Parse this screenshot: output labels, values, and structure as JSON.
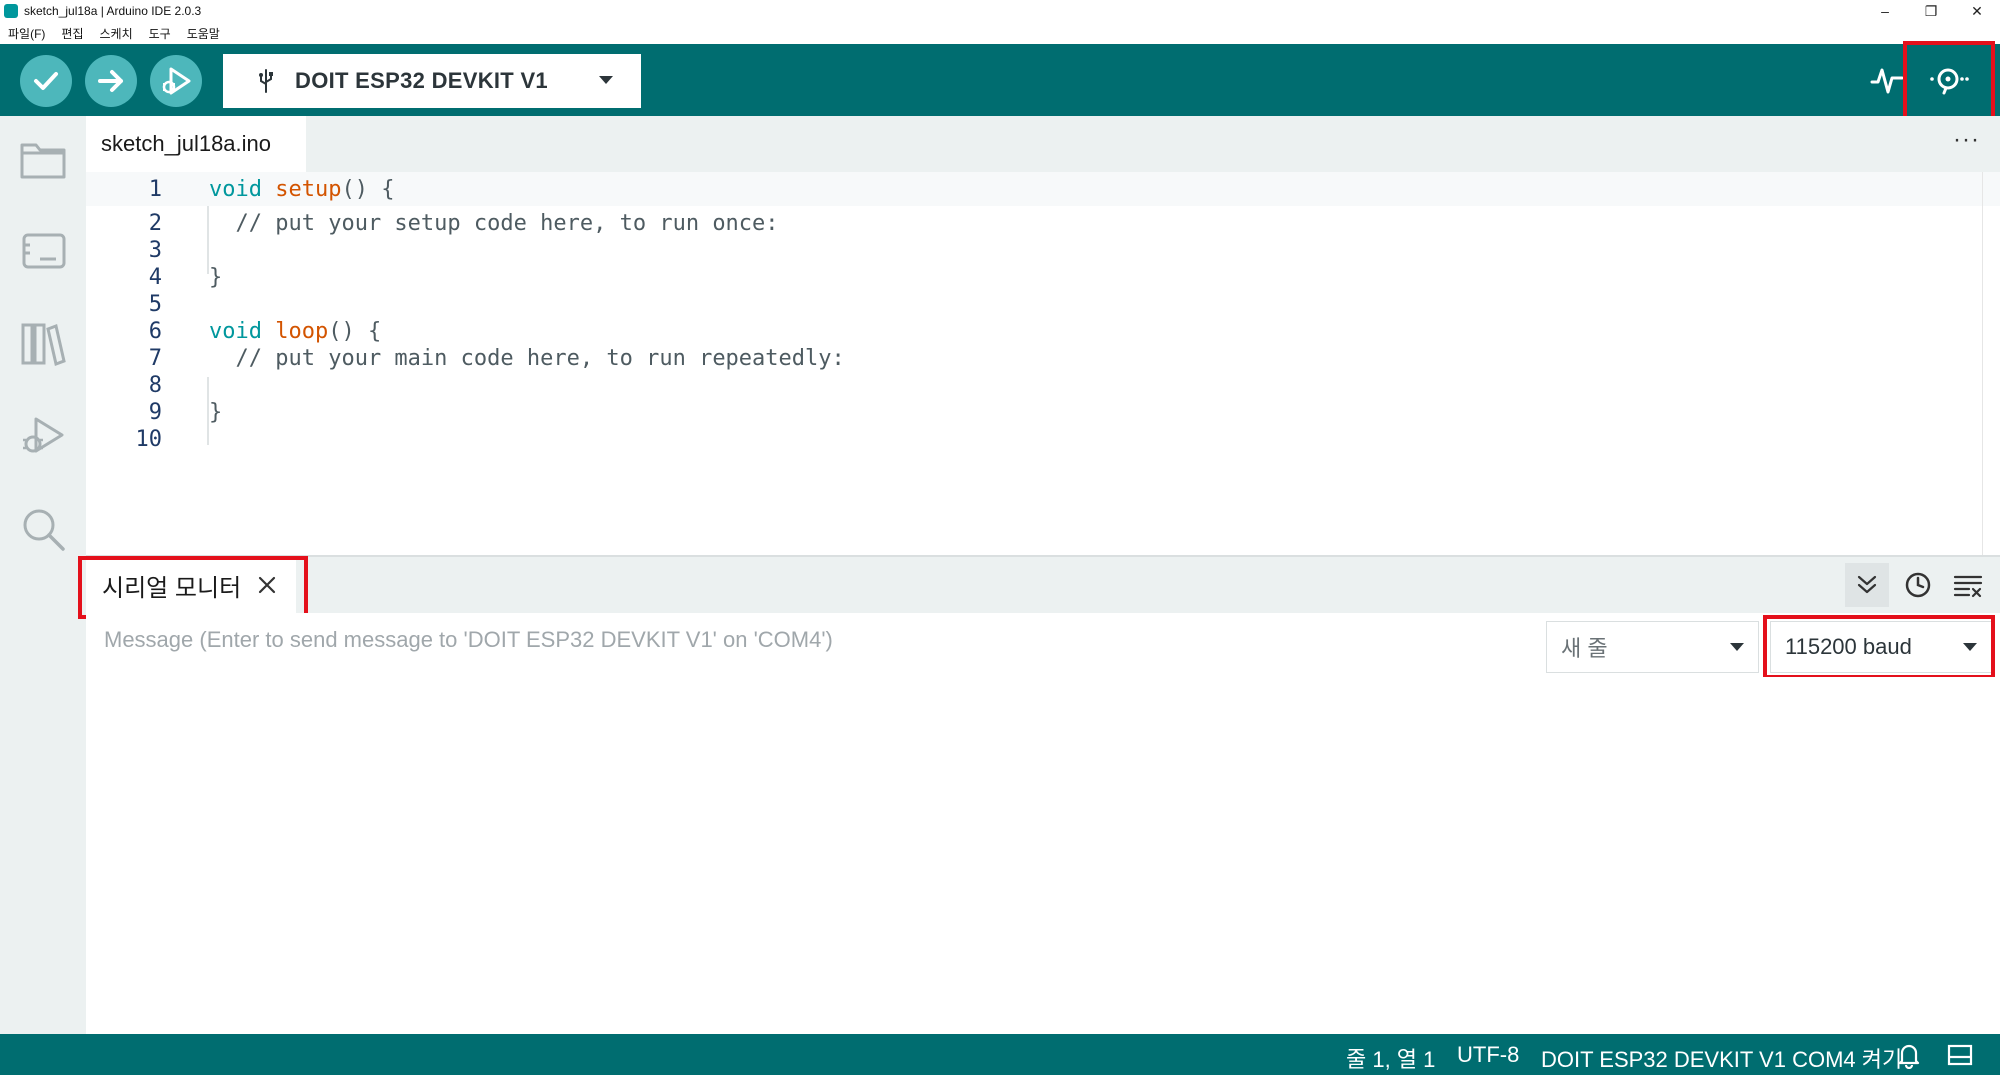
{
  "window": {
    "title": "sketch_jul18a | Arduino IDE 2.0.3",
    "controls": [
      "–",
      "❐",
      "✕"
    ]
  },
  "menubar": {
    "items": [
      "파일(F)",
      "편집",
      "스케치",
      "도구",
      "도움말"
    ]
  },
  "toolbar": {
    "verify_icon": "check-icon",
    "upload_icon": "arrow-right-icon",
    "debug_icon": "debug-icon",
    "board_name": "DOIT ESP32 DEVKIT V1",
    "plotter_icon": "serial-plotter-icon",
    "monitor_icon": "serial-monitor-icon"
  },
  "sidebar": {
    "items": [
      "folder-icon",
      "board-manager-icon",
      "library-icon",
      "debug-icon",
      "search-icon"
    ]
  },
  "editor": {
    "tab_name": "sketch_jul18a.ino",
    "more": "···",
    "lines": [
      {
        "n": "1"
      },
      {
        "n": "2"
      },
      {
        "n": "3"
      },
      {
        "n": "4"
      },
      {
        "n": "5"
      },
      {
        "n": "6"
      },
      {
        "n": "7"
      },
      {
        "n": "8"
      },
      {
        "n": "9"
      },
      {
        "n": "10"
      }
    ],
    "code": {
      "l1_kw": "void",
      "l1_fn": "setup",
      "l1_rest": "() {",
      "l2": "  // put your setup code here, to run once:",
      "l4": "}",
      "l6_kw": "void",
      "l6_fn": "loop",
      "l6_rest": "() {",
      "l7": "  // put your main code here, to run repeatedly:",
      "l9": "}"
    }
  },
  "serial_monitor": {
    "tab_label": "시리얼 모니터",
    "message_placeholder": "Message (Enter to send message to 'DOIT ESP32 DEVKIT V1' on 'COM4')",
    "line_ending": "새 줄",
    "baud_rate": "115200 baud"
  },
  "statusbar": {
    "position": "줄 1, 열 1",
    "encoding": "UTF-8",
    "board_port": "DOIT ESP32 DEVKIT V1 COM4 켜기"
  },
  "colors": {
    "teal_dark": "#006d70",
    "teal_button": "#4db7bb",
    "highlight_red": "#e4101b"
  }
}
